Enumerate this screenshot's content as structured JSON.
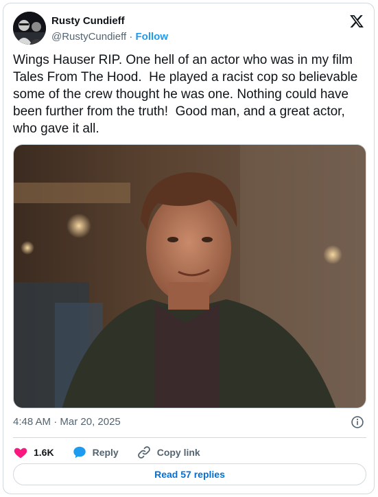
{
  "author": {
    "display_name": "Rusty Cundieff",
    "handle": "@RustyCundieff",
    "separator": "·",
    "follow_label": "Follow"
  },
  "tweet": {
    "text": "Wings Hauser RIP. One hell of an actor who was in my film Tales From The Hood.  He played a racist cop so believable some of the crew thought he was one. Nothing could have been further from the truth!  Good man, and a great actor, who gave it all.",
    "time": "4:48 AM",
    "date_separator": "·",
    "date": "Mar 20, 2025"
  },
  "actions": {
    "like_count": "1.6K",
    "reply_label": "Reply",
    "copy_link_label": "Copy link"
  },
  "footer": {
    "read_replies_label": "Read 57 replies"
  },
  "icons": {
    "brand": "x-logo-icon",
    "like": "heart-icon",
    "reply": "speech-bubble-icon",
    "copy": "link-icon",
    "info": "info-icon"
  },
  "colors": {
    "accent": "#1d9bf0",
    "link_text": "#006fd6",
    "like": "#f91880",
    "muted": "#536471",
    "border": "#cfd9de"
  }
}
